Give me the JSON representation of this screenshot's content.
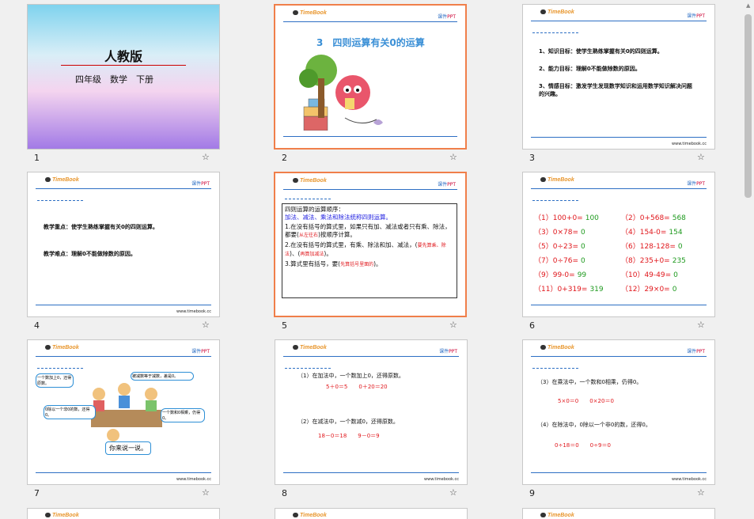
{
  "slides": [
    {
      "num": "1",
      "title": "人教版",
      "subtitle": "四年级　数学　下册"
    },
    {
      "num": "2",
      "heading": "3　四则运算有关0的运算"
    },
    {
      "num": "3",
      "lines": [
        "1、知识目标：使学生熟练掌握有关0的四则运算。",
        "2、能力目标：理解0不能做除数的原因。",
        "3、情感目标：激发学生发现数学知识和运用数学知识解决问题的兴趣。"
      ]
    },
    {
      "num": "4",
      "lines": [
        "教学重点：使学生熟练掌握有关0的四则运算。",
        "教学难点：理解0不能做除数的原因。"
      ]
    },
    {
      "num": "5",
      "box_title": "四则运算的运算顺序：",
      "box_sub": "加法、减法、乘法和除法统称四则运算。",
      "rule1": "1.在没有括号的算式里，如果只有加、减法或者只有乘、除法，都要(",
      "rule1_fill": "从左往右",
      "rule1_end": ")按顺序计算。",
      "rule2": "2.在没有括号的算式里，有乘、除法和加、减法，(",
      "rule2_fill1": "要先算乘、除法",
      "rule2_mid": ")、(",
      "rule2_fill2": "再算加减法",
      "rule2_end": ")。",
      "rule3": "3.算式里有括号，要(",
      "rule3_fill": "先算括号里面的",
      "rule3_end": ")。"
    },
    {
      "num": "6",
      "exprs": [
        {
          "q": "（1）100+0=",
          "a": "100"
        },
        {
          "q": "（2）0+568=",
          "a": "568"
        },
        {
          "q": "（3）0×78=",
          "a": "0"
        },
        {
          "q": "（4）154-0=",
          "a": "154"
        },
        {
          "q": "（5）0÷23=",
          "a": "0"
        },
        {
          "q": "（6）128-128=",
          "a": "0"
        },
        {
          "q": "（7）0÷76=",
          "a": "0"
        },
        {
          "q": "（8）235+0=",
          "a": "235"
        },
        {
          "q": "（9）99-0=",
          "a": "99"
        },
        {
          "q": "（10）49-49=",
          "a": "0"
        },
        {
          "q": "（11）0+319=",
          "a": "319"
        },
        {
          "q": "（12）29×0=",
          "a": "0"
        }
      ]
    },
    {
      "num": "7",
      "bubbles": [
        "一个数加上0，还得原数。",
        "被减数等于减数，差是0。",
        "0除以一个非0的数，还得0。",
        "一个数和0相乘，仍得0。"
      ],
      "caption": "你来说一说。"
    },
    {
      "num": "8",
      "l1": "（1）在加法中，一个数加上0，还得原数。",
      "e1": "5＋0＝5　　0＋20＝20",
      "l2": "（2）在减法中，一个数减0，还得原数。",
      "e2": "18－0＝18　　9－0＝9"
    },
    {
      "num": "9",
      "l1": "（3）在乘法中，一个数和0相乘，仍得0。",
      "e1": "5×0＝0　　0×20＝0",
      "l2": "（4）在除法中，0除以一个非0的数，还得0。",
      "e2": "0÷18＝0　　0÷9＝0"
    }
  ],
  "brand": {
    "logo": "TimeBook",
    "tag": "课件",
    "tag_suffix": "PPT",
    "site": "www.timebook.cc"
  },
  "icons": {
    "star": "star-icon"
  }
}
